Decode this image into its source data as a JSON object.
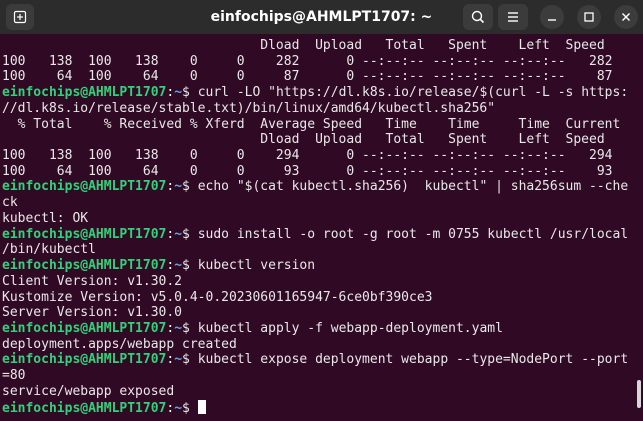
{
  "window": {
    "title": "einfochips@AHMLPT1707: ~",
    "buttons": {
      "new_tab_icon": "new-tab-icon",
      "search_icon": "search-icon",
      "menu_icon": "hamburger-menu-icon",
      "minimize_icon": "minimize-icon",
      "maximize_icon": "maximize-icon",
      "close_icon": "close-icon"
    }
  },
  "colors": {
    "background": "#300a24",
    "prompt_user": "#33d17a",
    "prompt_path": "#62a0ea",
    "text": "#e8e8e8"
  },
  "terminal": {
    "prompt": {
      "user_host": "einfochips@AHMLPT1707",
      "separator": ":",
      "path": "~",
      "symbol": "$ "
    },
    "lines": [
      {
        "type": "output",
        "text": "                                 Dload  Upload   Total   Spent    Left  Speed"
      },
      {
        "type": "output",
        "text": "100   138  100   138    0     0    282      0 --:--:-- --:--:-- --:--:--   282"
      },
      {
        "type": "output",
        "text": "100    64  100    64    0     0     87      0 --:--:-- --:--:-- --:--:--    87"
      },
      {
        "type": "prompt",
        "text": "curl -LO \"https://dl.k8s.io/release/$(curl -L -s https:"
      },
      {
        "type": "output",
        "text": "//dl.k8s.io/release/stable.txt)/bin/linux/amd64/kubectl.sha256\""
      },
      {
        "type": "output",
        "text": "  % Total    % Received % Xferd  Average Speed   Time    Time     Time  Current"
      },
      {
        "type": "output",
        "text": "                                 Dload  Upload   Total   Spent    Left  Speed"
      },
      {
        "type": "output",
        "text": "100   138  100   138    0     0    294      0 --:--:-- --:--:-- --:--:--   294"
      },
      {
        "type": "output",
        "text": "100    64  100    64    0     0     93      0 --:--:-- --:--:-- --:--:--    93"
      },
      {
        "type": "prompt",
        "text": "echo \"$(cat kubectl.sha256)  kubectl\" | sha256sum --che"
      },
      {
        "type": "output",
        "text": "ck"
      },
      {
        "type": "output",
        "text": "kubectl: OK"
      },
      {
        "type": "prompt",
        "text": "sudo install -o root -g root -m 0755 kubectl /usr/local"
      },
      {
        "type": "output",
        "text": "/bin/kubectl"
      },
      {
        "type": "prompt",
        "text": "kubectl version"
      },
      {
        "type": "output",
        "text": "Client Version: v1.30.2"
      },
      {
        "type": "output",
        "text": "Kustomize Version: v5.0.4-0.20230601165947-6ce0bf390ce3"
      },
      {
        "type": "output",
        "text": "Server Version: v1.30.0"
      },
      {
        "type": "prompt",
        "text": "kubectl apply -f webapp-deployment.yaml"
      },
      {
        "type": "output",
        "text": "deployment.apps/webapp created"
      },
      {
        "type": "prompt",
        "text": "kubectl expose deployment webapp --type=NodePort --port"
      },
      {
        "type": "output",
        "text": "=80"
      },
      {
        "type": "output",
        "text": "service/webapp exposed"
      },
      {
        "type": "prompt",
        "text": "",
        "cursor": true
      }
    ]
  }
}
